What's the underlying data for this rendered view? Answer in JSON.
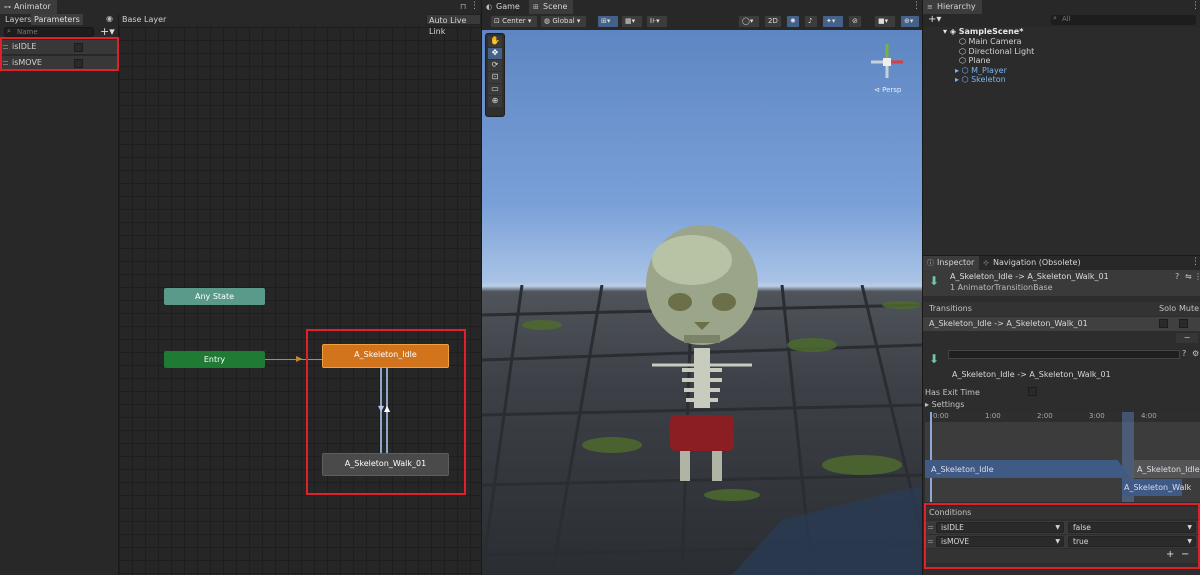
{
  "animator": {
    "tab_title": "Animator",
    "tab_layers": "Layers",
    "tab_parameters": "Parameters",
    "search_placeholder": "Name",
    "base_layer": "Base Layer",
    "auto_live_link": "Auto Live Link",
    "parameters": [
      {
        "name": "isIDLE"
      },
      {
        "name": "isMOVE"
      }
    ],
    "states": {
      "any_state": "Any State",
      "entry": "Entry",
      "idle": "A_Skeleton_Idle",
      "walk": "A_Skeleton_Walk_01"
    },
    "colors": {
      "any_state": "#5a9a8a",
      "entry": "#1f7a34",
      "idle": "#d2741c",
      "walk": "#4a4a4a"
    }
  },
  "scene": {
    "tab_game": "Game",
    "tab_scene": "Scene",
    "pivot": "Center",
    "space": "Global",
    "mode_2d": "2D",
    "persp_label": "Persp"
  },
  "hierarchy": {
    "tab_title": "Hierarchy",
    "search_placeholder": "All",
    "scene_name": "SampleScene*",
    "items": [
      {
        "label": "Main Camera",
        "blue": false,
        "expand": false
      },
      {
        "label": "Directional Light",
        "blue": false,
        "expand": false
      },
      {
        "label": "Plane",
        "blue": false,
        "expand": false
      },
      {
        "label": "M_Player",
        "blue": true,
        "expand": true
      },
      {
        "label": "Skeleton",
        "blue": true,
        "expand": true
      }
    ]
  },
  "inspector": {
    "tab_inspector": "Inspector",
    "tab_navigation": "Navigation (Obsolete)",
    "header_title": "A_Skeleton_Idle -> A_Skeleton_Walk_01",
    "header_sub": "1 AnimatorTransitionBase",
    "transitions_label": "Transitions",
    "solo_label": "Solo",
    "mute_label": "Mute",
    "transition_item": "A_Skeleton_Idle -> A_Skeleton_Walk_01",
    "minus": "−",
    "transition_name": "A_Skeleton_Idle -> A_Skeleton_Walk_01",
    "has_exit_time": "Has Exit Time",
    "settings": "Settings",
    "timeline_ticks": [
      "0:00",
      "1:00",
      "2:00",
      "3:00",
      "4:00"
    ],
    "clip_idle": "A_Skeleton_Idle",
    "clip_idle_right": "A_Skeleton_Idle",
    "clip_walk": "A_Skeleton_Walk",
    "conditions_label": "Conditions",
    "conditions": [
      {
        "param": "isIDLE",
        "value": "false"
      },
      {
        "param": "isMOVE",
        "value": "true"
      }
    ],
    "plus": "+",
    "minus2": "−"
  }
}
